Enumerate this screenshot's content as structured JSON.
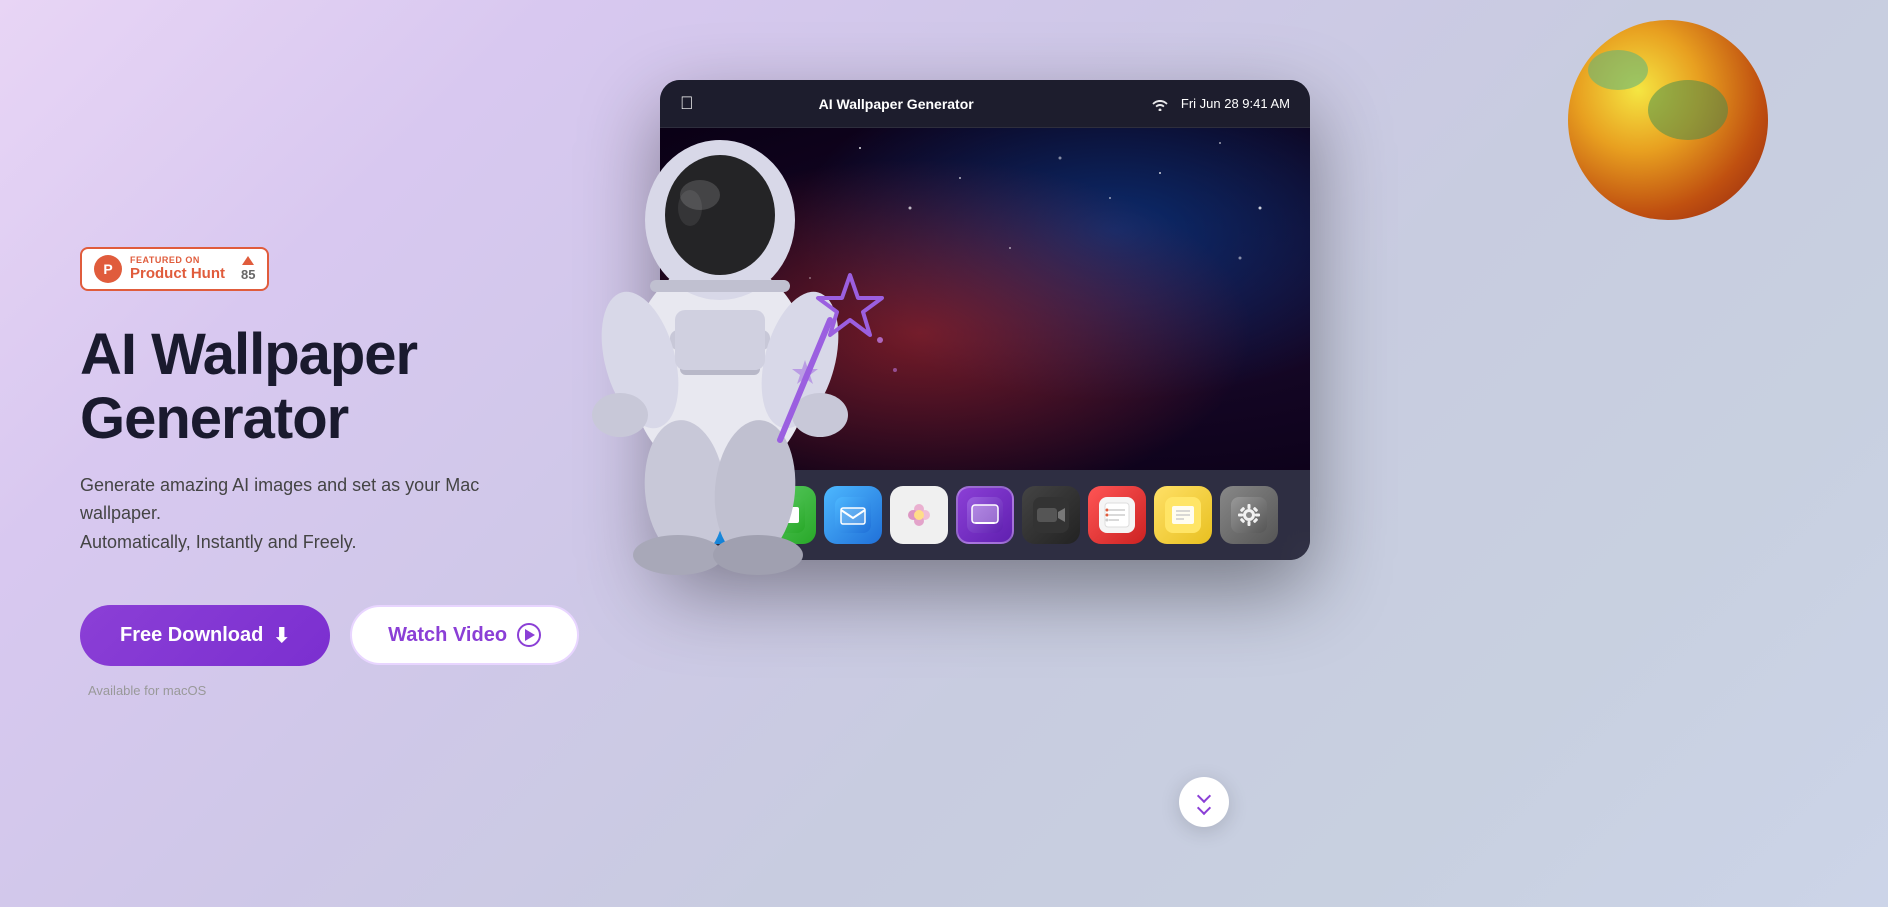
{
  "page": {
    "title": "AI Wallpaper Generator"
  },
  "badge": {
    "featured_label": "FEATURED ON",
    "name": "Product Hunt",
    "votes": "85"
  },
  "hero": {
    "title": "AI Wallpaper Generator",
    "subtitle_line1": "Generate amazing AI images and set as your Mac wallpaper.",
    "subtitle_line2": "Automatically, Instantly and Freely.",
    "download_button": "Free Download",
    "watch_button": "Watch Video",
    "available_text": "Available for macOS"
  },
  "mac_window": {
    "apple_symbol": "",
    "app_name": "AI Wallpaper Generator",
    "menu_icon": "⊞",
    "wifi_icon": "wifi",
    "datetime": "Fri Jun 28  9:41 AM"
  },
  "dock": {
    "icons": [
      {
        "name": "Finder",
        "class": "finder",
        "emoji": "🔵"
      },
      {
        "name": "Messages",
        "class": "messages",
        "emoji": "💬"
      },
      {
        "name": "Mail",
        "class": "mail",
        "emoji": "✉️"
      },
      {
        "name": "Flower/Photos",
        "class": "flower",
        "emoji": "🌸"
      },
      {
        "name": "AI Wallpaper",
        "class": "wallpaper",
        "emoji": "🖼"
      },
      {
        "name": "Video",
        "class": "video",
        "emoji": "🎬"
      },
      {
        "name": "Reminders",
        "class": "reminders",
        "emoji": "📋"
      },
      {
        "name": "Notes",
        "class": "notes",
        "emoji": "📝"
      },
      {
        "name": "System Preferences",
        "class": "system",
        "emoji": "⚙️"
      }
    ]
  },
  "scroll": {
    "label": "scroll down"
  }
}
